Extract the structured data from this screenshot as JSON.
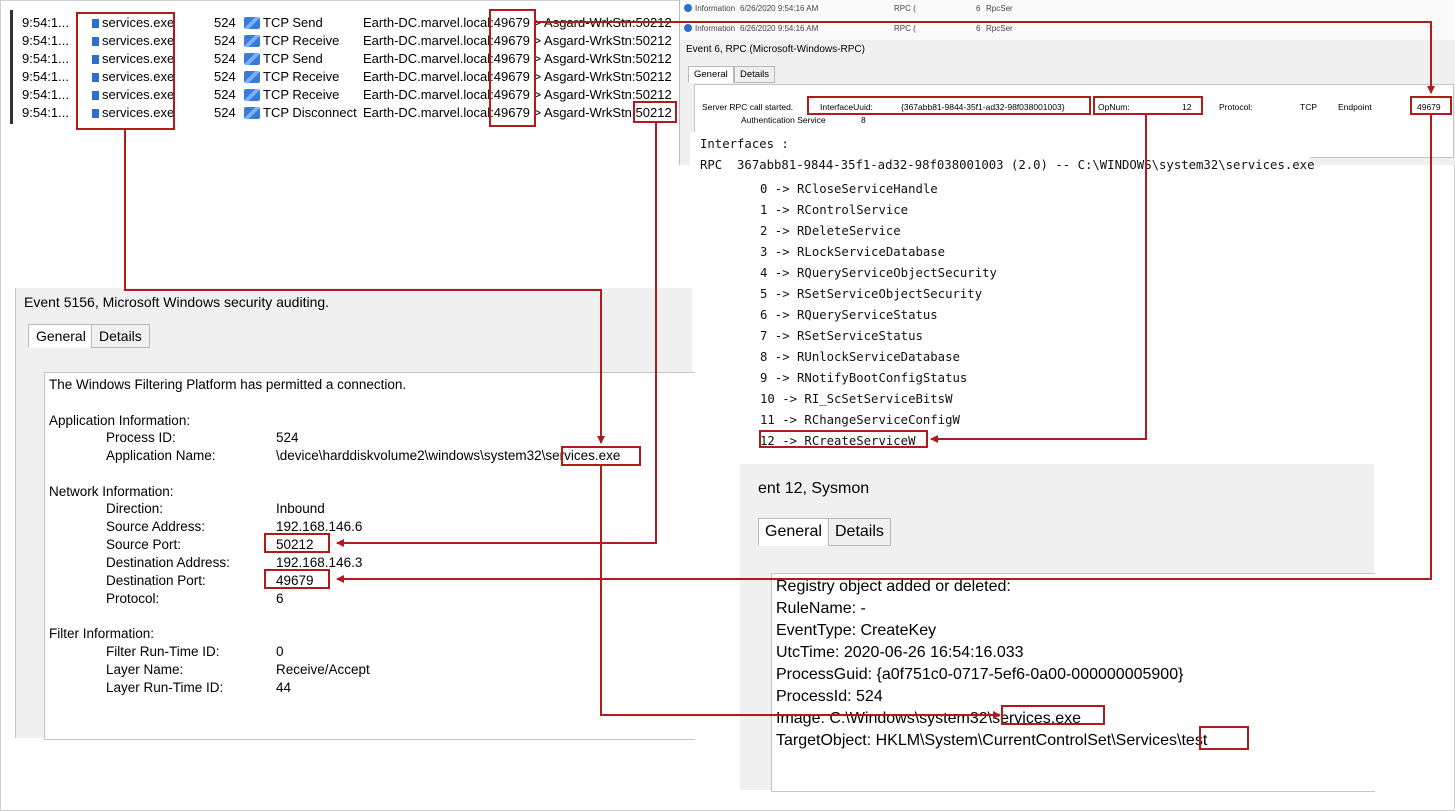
{
  "procmon": {
    "rows": [
      {
        "time": "9:54:1...",
        "process": "services.exe",
        "pid": "524",
        "operation": "TCP Send",
        "path": "Earth-DC.marvel.local:",
        "src_port": "49679",
        "dest": " > Asgard-WrkStn:50212"
      },
      {
        "time": "9:54:1...",
        "process": "services.exe",
        "pid": "524",
        "operation": "TCP Receive",
        "path": "Earth-DC.marvel.local:",
        "src_port": "49679",
        "dest": " > Asgard-WrkStn:50212"
      },
      {
        "time": "9:54:1...",
        "process": "services.exe",
        "pid": "524",
        "operation": "TCP Send",
        "path": "Earth-DC.marvel.local:",
        "src_port": "49679",
        "dest": " > Asgard-WrkStn:50212"
      },
      {
        "time": "9:54:1...",
        "process": "services.exe",
        "pid": "524",
        "operation": "TCP Receive",
        "path": "Earth-DC.marvel.local:",
        "src_port": "49679",
        "dest": " > Asgard-WrkStn:50212"
      },
      {
        "time": "9:54:1...",
        "process": "services.exe",
        "pid": "524",
        "operation": "TCP Receive",
        "path": "Earth-DC.marvel.local:",
        "src_port": "49679",
        "dest": " > Asgard-WrkStn:50212"
      },
      {
        "time": "9:54:1...",
        "process": "services.exe",
        "pid": "524",
        "operation": "TCP Disconnect",
        "path": "Earth-DC.marvel.local:",
        "src_port": "49679",
        "dest": " > Asgard-WrkStn:50212"
      }
    ]
  },
  "rpc_event": {
    "faded_rows": [
      {
        "level": "Information",
        "date": "6/26/2020 9:54:16 AM",
        "source": "RPC (",
        "id": "6",
        "task": "RpcSer"
      },
      {
        "level": "Information",
        "date": "6/26/2020 9:54:16 AM",
        "source": "RPC (",
        "id": "6",
        "task": "RpcSer"
      }
    ],
    "title": "Event 6, RPC (Microsoft-Windows-RPC)",
    "tab_general": "General",
    "tab_details": "Details",
    "line1_label": "Server RPC call started.",
    "interface_label": "InterfaceUuid:",
    "interface_value": "{367abb81-9844-35f1-ad32-98f038001003}",
    "opnum_label": "OpNum:",
    "opnum_value": "12",
    "protocol_label": "Protocol:",
    "protocol_value": "TCP",
    "endpoint_label": "Endpoint",
    "endpoint_value": "49679",
    "auth_label": "Authentication Service",
    "auth_value": "8"
  },
  "interfaces": {
    "header": "Interfaces :",
    "rpc_line": "RPC  367abb81-9844-35f1-ad32-98f038001003 (2.0) -- C:\\WINDOWS\\system32\\services.exe",
    "ops": [
      "0 -> RCloseServiceHandle",
      "1 -> RControlService",
      "2 -> RDeleteService",
      "3 -> RLockServiceDatabase",
      "4 -> RQueryServiceObjectSecurity",
      "5 -> RSetServiceObjectSecurity",
      "6 -> RQueryServiceStatus",
      "7 -> RSetServiceStatus",
      "8 -> RUnlockServiceDatabase",
      "9 -> RNotifyBootConfigStatus",
      "10 -> RI_ScSetServiceBitsW",
      "11 -> RChangeServiceConfigW",
      "12 -> RCreateServiceW"
    ]
  },
  "event5156": {
    "title": "Event 5156, Microsoft Windows security auditing.",
    "tab_general": "General",
    "tab_details": "Details",
    "summary": "The Windows Filtering Platform has permitted a connection.",
    "app_header": "Application Information:",
    "process_id_label": "Process ID:",
    "process_id": "524",
    "app_name_label": "Application Name:",
    "app_name_prefix": "\\device\\harddiskvolume2\\windows\\system32\\",
    "app_name_file": "services.exe",
    "net_header": "Network Information:",
    "direction_label": "Direction:",
    "direction": "Inbound",
    "src_addr_label": "Source Address:",
    "src_addr": "192.168.146.6",
    "src_port_label": "Source Port:",
    "src_port": "50212",
    "dst_addr_label": "Destination Address:",
    "dst_addr": "192.168.146.3",
    "dst_port_label": "Destination Port:",
    "dst_port": "49679",
    "protocol_label": "Protocol:",
    "protocol": "6",
    "filter_header": "Filter Information:",
    "filter_rt_label": "Filter Run-Time ID:",
    "filter_rt": "0",
    "layer_name_label": "Layer Name:",
    "layer_name": "Receive/Accept",
    "layer_rt_label": "Layer Run-Time ID:",
    "layer_rt": "44"
  },
  "event12": {
    "title": "ent 12, Sysmon",
    "tab_general": "General",
    "tab_details": "Details",
    "line_registry": "Registry object added or deleted:",
    "line_rulename": "RuleName: -",
    "line_eventtype": "EventType: CreateKey",
    "line_utctime": "UtcTime: 2020-06-26 16:54:16.033",
    "line_guid": "ProcessGuid: {a0f751c0-0717-5ef6-0a00-000000005900}",
    "line_pid": "ProcessId: 524",
    "image_prefix": "Image: C:\\Windows\\system32\\",
    "image_file": "services.exe",
    "target_prefix": "TargetObject: HKLM\\System\\CurrentControlSet\\Services\\",
    "target_key": "test"
  },
  "colors": {
    "annotation": "#b01c1c",
    "window_bg": "#f0f0f0",
    "procmon_icon": "#2b6fd1"
  }
}
